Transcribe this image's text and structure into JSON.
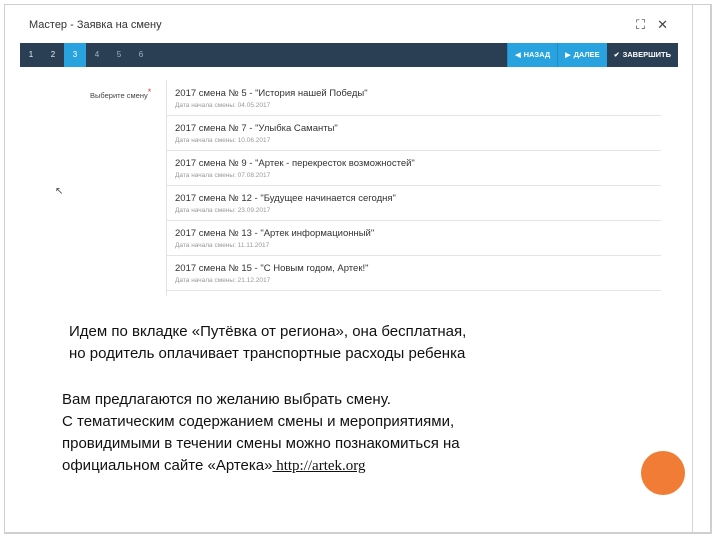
{
  "dialog": {
    "title": "Мастер - Заявка на смену",
    "maximize_icon": "⛶",
    "close_icon": "✕"
  },
  "steps": [
    "1",
    "2",
    "3",
    "4",
    "5",
    "6"
  ],
  "nav": {
    "back": "НАЗАД",
    "next": "ДАЛЕЕ",
    "finish": "ЗАВЕРШИТЬ"
  },
  "form": {
    "label": "Выберите смену",
    "required_mark": "*"
  },
  "shifts": [
    {
      "title": "2017 смена № 5 - \"История нашей Победы\"",
      "date": "Дата начала смены: 04.05.2017"
    },
    {
      "title": "2017 смена № 7 - \"Улыбка Саманты\"",
      "date": "Дата начала смены: 10.06.2017"
    },
    {
      "title": "2017 смена № 9 - \"Артек - перекресток возможностей\"",
      "date": "Дата начала смены: 07.08.2017"
    },
    {
      "title": "2017 смена № 12 - \"Будущее начинается сегодня\"",
      "date": "Дата начала смены: 23.09.2017"
    },
    {
      "title": "2017 смена № 13 - \"Артек информационный\"",
      "date": "Дата начала смены: 11.11.2017"
    },
    {
      "title": "2017 смена № 15 - \"С Новым годом, Артек!\"",
      "date": "Дата начала смены: 21.12.2017"
    }
  ],
  "caption1": {
    "line1": "Идем по вкладке «Путёвка от региона», она бесплатная,",
    "line2": "но родитель оплачивает транспортные расходы ребенка"
  },
  "caption2": {
    "line1": "Вам предлагаются по желанию выбрать смену.",
    "line2": "С тематическим содержанием смены и мероприятиями,",
    "line3": "провидимыми в течении смены можно познакомиться на",
    "line4": "официальном сайте «Артека»",
    "link": " http://artek.org"
  },
  "colors": {
    "stepbar": "#2a3f54",
    "accent": "#29a3e0",
    "orange_dot": "#f07c35"
  }
}
